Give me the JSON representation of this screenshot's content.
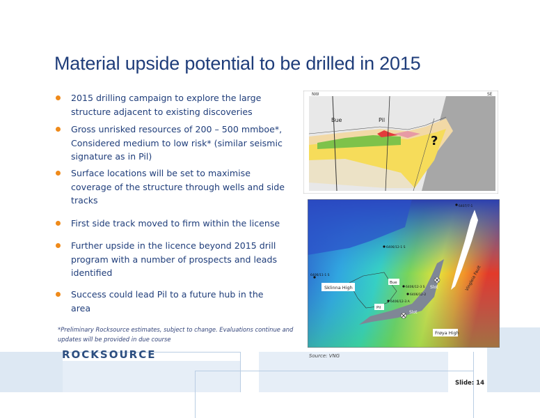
{
  "slide": {
    "title": "Material upside potential to be drilled in 2015",
    "bullets": [
      "2015 drilling campaign to explore the large structure adjacent to existing discoveries",
      "Gross unrisked resources of 200 – 500 mmboe*, Considered medium to low risk* (similar seismic signature as in Pil)",
      "Surface locations will be set to maximise coverage of the structure through wells and side tracks",
      "First side track moved to firm within the license",
      "Further upside in the licence beyond 2015 drill program with a number of prospects and leads identified",
      "Success could lead Pil to a future hub in the area"
    ],
    "footnote": "*Preliminary Rocksource estimates, subject to change. Evaluations continue and updates will be provided in due course",
    "logo_text": "ROCKSOURCE",
    "source": "Source: VNG",
    "slide_number": "Slide: 14",
    "accent_color": "#ef8a1a",
    "title_color": "#1f3d7a"
  },
  "cross_section": {
    "left_label": "NW",
    "right_label": "SE",
    "well_1_label": "Bue",
    "well_2_label": "Pil",
    "question_mark": "?"
  },
  "map": {
    "labels": {
      "solvera_high": "Sklinna High",
      "frøya_high": "Frøya High",
      "vingleia_fault": "Vingleia Fault",
      "slot_1": "Slot",
      "slot_2": "Slot",
      "bue": "Bue",
      "pil": "Pil",
      "well_a": "6406/12-1 S",
      "well_b": "6406/12-3 S",
      "well_c": "6406/12-2",
      "well_d": "6406/11-1 S",
      "well_e": "6406/12-3 A",
      "well_f": "6407/7-1"
    }
  }
}
